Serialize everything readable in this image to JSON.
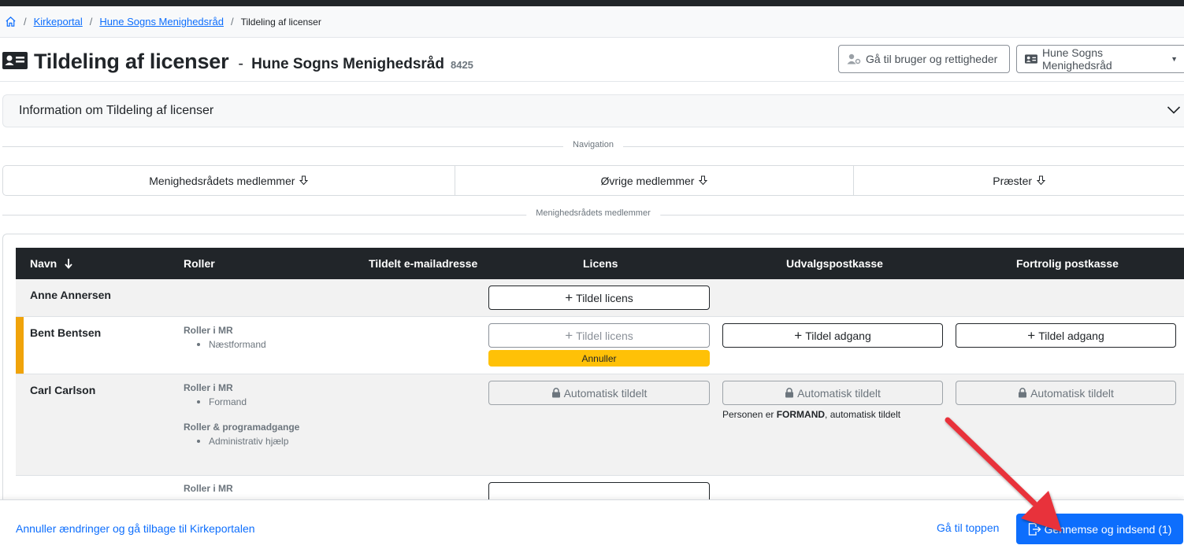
{
  "breadcrumb": {
    "items": [
      "Kirkeportal",
      "Hune Sogns Menighedsråd"
    ],
    "current": "Tildeling af licenser"
  },
  "header": {
    "title": "Tildeling af licenser",
    "dash": "-",
    "council_name": "Hune Sogns Menighedsråd",
    "council_number": "8425",
    "user_rights_button": "Gå til bruger og rettigheder",
    "council_select": "Hune Sogns Menighedsråd"
  },
  "info_panel": {
    "label": "Information om Tildeling af licenser"
  },
  "navigation": {
    "label": "Navigation",
    "items": [
      "Menighedsrådets medlemmer",
      "Øvrige medlemmer",
      "Præster"
    ]
  },
  "section": {
    "label": "Menighedsrådets medlemmer"
  },
  "table": {
    "columns": [
      "Navn",
      "Roller",
      "Tildelt e-mailadresse",
      "Licens",
      "Udvalgspostkasse",
      "Fortrolig postkasse"
    ],
    "rows": [
      {
        "name": "Anne Annersen",
        "license_button": "Tildel licens"
      },
      {
        "name": "Bent Bentsen",
        "roles_heading": "Roller i MR",
        "roles": [
          "Næstformand"
        ],
        "license_button": "Tildel licens",
        "cancel_button": "Annuller",
        "committee_button": "Tildel adgang",
        "confidential_button": "Tildel adgang"
      },
      {
        "name": "Carl Carlson",
        "roles_heading": "Roller i MR",
        "roles": [
          "Formand"
        ],
        "roles2_heading": "Roller & programadgange",
        "roles2": [
          "Administrativ hjælp"
        ],
        "license_button": "Automatisk tildelt",
        "committee_button": "Automatisk tildelt",
        "confidential_button": "Automatisk tildelt",
        "note_prefix": "Personen er ",
        "note_bold": "FORMAND",
        "note_suffix": ", automatisk tildelt"
      },
      {
        "roles_heading": "Roller i MR"
      }
    ]
  },
  "footer": {
    "cancel_link": "Annuller ændringer og gå tilbage til Kirkeportalen",
    "top_link": "Gå til toppen",
    "submit_button": "Gennemse og indsend (1)"
  },
  "colors": {
    "primary": "#0d6efd",
    "dark": "#212529",
    "warning": "#ffc107",
    "row_accent": "#f0a30a",
    "annotation_arrow": "#e8333a"
  }
}
